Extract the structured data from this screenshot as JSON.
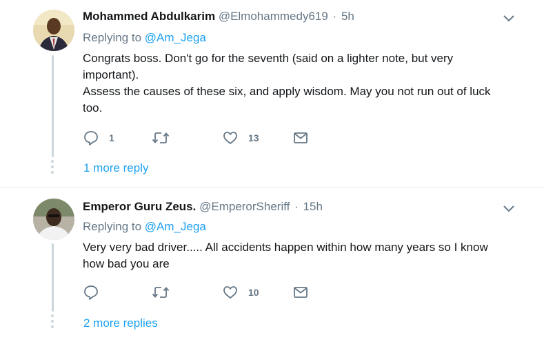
{
  "tweets": [
    {
      "name": "Mohammed Abdulkarim",
      "handle": "@Elmohammedy619",
      "separator": "·",
      "time": "5h",
      "replying_label": "Replying to",
      "replying_to": "@Am_Jega",
      "body": [
        "Congrats boss. Don't go for the seventh (said on a lighter note, but very important).",
        "Assess the causes of these six, and apply wisdom. May you not run out of luck too."
      ],
      "reply_count": "1",
      "retweet_count": "",
      "like_count": "13",
      "more_replies": "1 more reply"
    },
    {
      "name": "Emperor Guru Zeus.",
      "handle": "@EmperorSheriff",
      "separator": "·",
      "time": "15h",
      "replying_label": "Replying to",
      "replying_to": "@Am_Jega",
      "body": [
        "Very very bad driver..... All accidents happen within how many years so I know how bad you are"
      ],
      "reply_count": "",
      "retweet_count": "",
      "like_count": "10",
      "more_replies": "2 more replies"
    }
  ],
  "icons": {
    "reply": "reply-icon",
    "retweet": "retweet-icon",
    "like": "heart-icon",
    "dm": "envelope-icon",
    "menu": "chevron-down-icon"
  },
  "colors": {
    "link": "#1da1f2",
    "muted": "#657786",
    "text": "#14171a",
    "thread": "#ccd6dd"
  }
}
